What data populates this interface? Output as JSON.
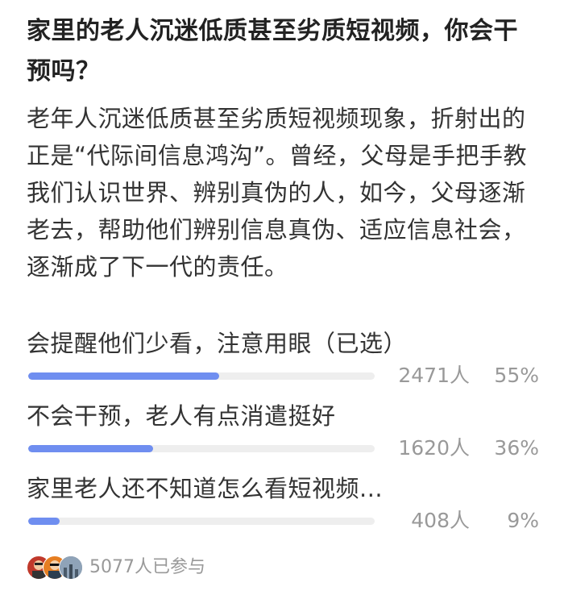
{
  "poll": {
    "title": "家里的老人沉迷低质甚至劣质短视频，你会干预吗？",
    "description": "老年人沉迷低质甚至劣质短视频现象，折射出的正是“代际间信息鸿沟”。曾经，父母是手把手教我们认识世界、辨别真伪的人，如今，父母逐渐老去，帮助他们辨别信息真伪、适应信息社会，逐渐成了下一代的责任。",
    "options": [
      {
        "label": "会提醒他们少看，注意用眼（已选）",
        "count": "2471人",
        "percent": "55%",
        "fraction": 0.55
      },
      {
        "label": "不会干预，老人有点消遣挺好",
        "count": "1620人",
        "percent": "36%",
        "fraction": 0.36
      },
      {
        "label": "家里老人还不知道怎么看短视频...",
        "count": "408人",
        "percent": "9%",
        "fraction": 0.09
      }
    ],
    "participants": "5077人已参与"
  },
  "colors": {
    "bar_fill": "#6f8ef0",
    "bar_track": "#eeeeee",
    "muted_text": "#999999"
  }
}
